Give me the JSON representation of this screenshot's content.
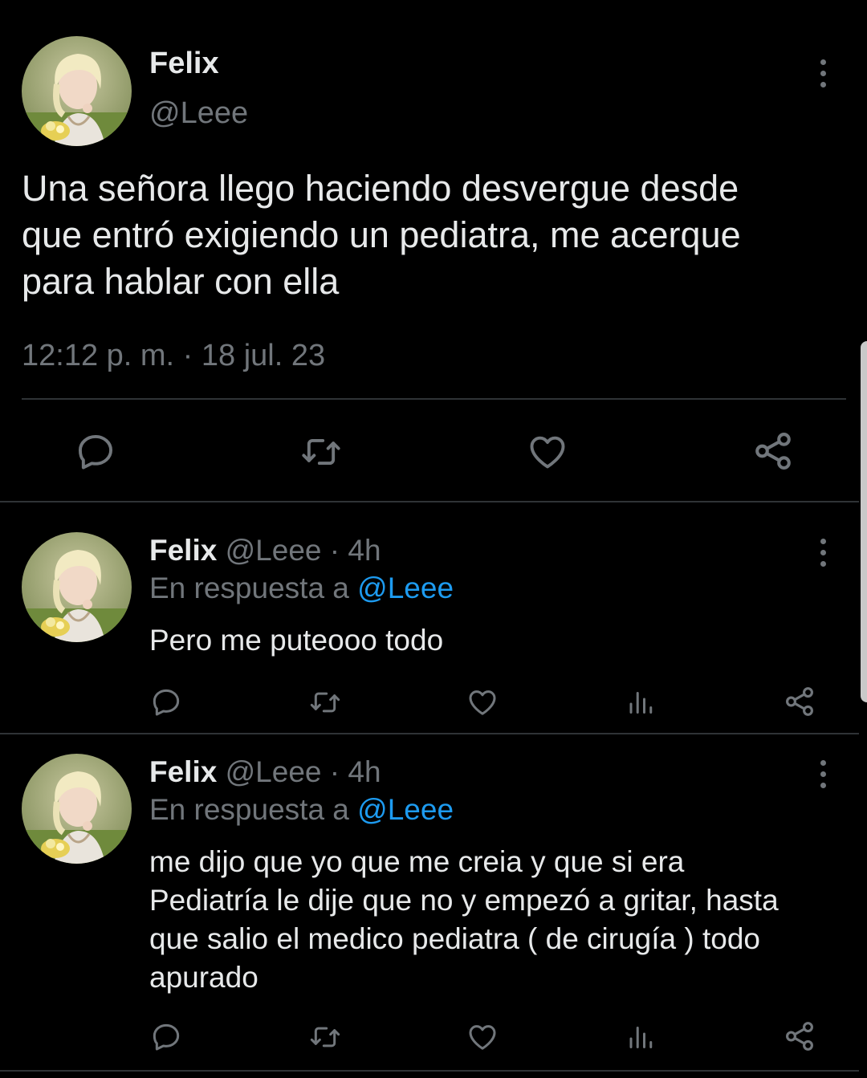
{
  "main_tweet": {
    "name": "Felix",
    "handle": "@Leee",
    "text_lines": [
      "Una señora llego haciendo desvergue desde",
      "que entró exigiendo un pediatra, me acerque",
      "para hablar con ella"
    ],
    "timestamp": "12:12 p. m. · 18 jul. 23",
    "actions": [
      "reply-icon",
      "retweet-icon",
      "like-icon",
      "share-icon"
    ]
  },
  "replies": [
    {
      "name": "Felix",
      "meta": "@Leee · 4h",
      "reply_prefix": "En respuesta a",
      "reply_to": "@Leee",
      "text_lines": [
        "Pero me puteooo todo"
      ],
      "actions": [
        "reply-icon",
        "retweet-icon",
        "like-icon",
        "views-icon",
        "share-icon"
      ]
    },
    {
      "name": "Felix",
      "meta": "@Leee · 4h",
      "reply_prefix": "En respuesta a",
      "reply_to": "@Leee",
      "text_lines": [
        "me dijo que yo que me creia y que si era",
        "Pediatría le dije que no y empezó a gritar, hasta",
        "que salio el medico pediatra ( de cirugía ) todo",
        "apurado"
      ],
      "actions": [
        "reply-icon",
        "retweet-icon",
        "like-icon",
        "views-icon",
        "share-icon"
      ]
    }
  ],
  "colors": {
    "background": "#000000",
    "text": "#e7e9ea",
    "muted": "#71767b",
    "link": "#1d9bf0",
    "divider": "#2f3336"
  }
}
